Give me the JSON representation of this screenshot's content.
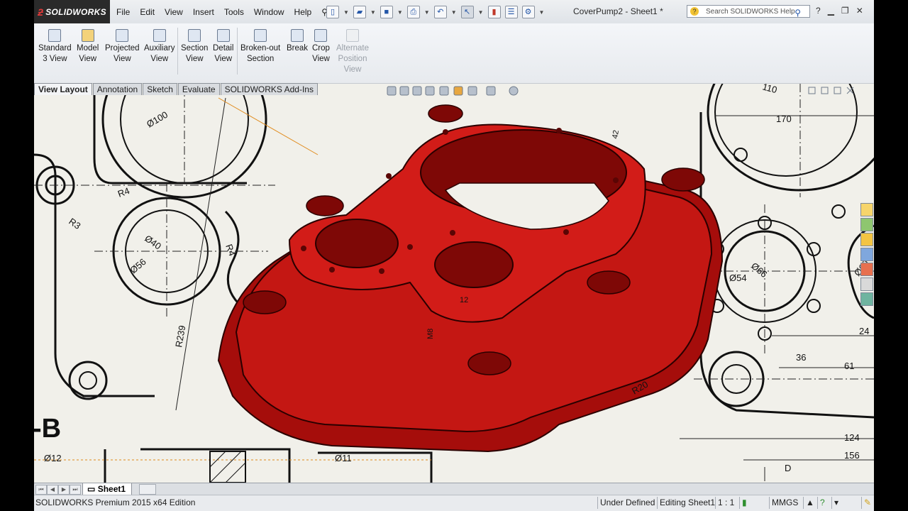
{
  "app": {
    "logo_text": "SOLIDWORKS",
    "doc_title": "CoverPump2 - Sheet1 *",
    "search_placeholder": "Search SOLIDWORKS Help"
  },
  "menu": [
    "File",
    "Edit",
    "View",
    "Insert",
    "Tools",
    "Window",
    "Help"
  ],
  "toolbar": {
    "tools": [
      {
        "line1": "Standard",
        "line2": "3 View",
        "line3": ""
      },
      {
        "line1": "Model",
        "line2": "View",
        "line3": ""
      },
      {
        "line1": "Projected",
        "line2": "View",
        "line3": ""
      },
      {
        "line1": "Auxiliary",
        "line2": "View",
        "line3": ""
      },
      {
        "line1": "Section",
        "line2": "View",
        "line3": ""
      },
      {
        "line1": "Detail",
        "line2": "View",
        "line3": ""
      },
      {
        "line1": "Broken-out",
        "line2": "Section",
        "line3": ""
      },
      {
        "line1": "Break",
        "line2": "",
        "line3": ""
      },
      {
        "line1": "Crop",
        "line2": "View",
        "line3": ""
      },
      {
        "line1": "Alternate",
        "line2": "Position",
        "line3": "View"
      }
    ]
  },
  "tabs": [
    "View Layout",
    "Annotation",
    "Sketch",
    "Evaluate",
    "SOLIDWORKS Add-Ins"
  ],
  "drawing": {
    "dims": [
      "Ø100",
      "R4",
      "R3",
      "Ø40",
      "Ø56",
      "R4",
      "R239",
      "Ø12",
      "Ø11",
      "-B",
      "R20",
      "110",
      "170",
      "Ø66",
      "Ø54",
      "Ø60",
      "24",
      "36",
      "61",
      "124",
      "156",
      "D",
      "M8",
      "12",
      "42"
    ],
    "model_color": "#c0120e"
  },
  "sheet": {
    "tab_label": "Sheet1"
  },
  "status": {
    "edition": "SOLIDWORKS Premium 2015 x64 Edition",
    "defined": "Under Defined",
    "editing": "Editing Sheet1",
    "scale": "1 : 1",
    "units": "MMGS"
  }
}
